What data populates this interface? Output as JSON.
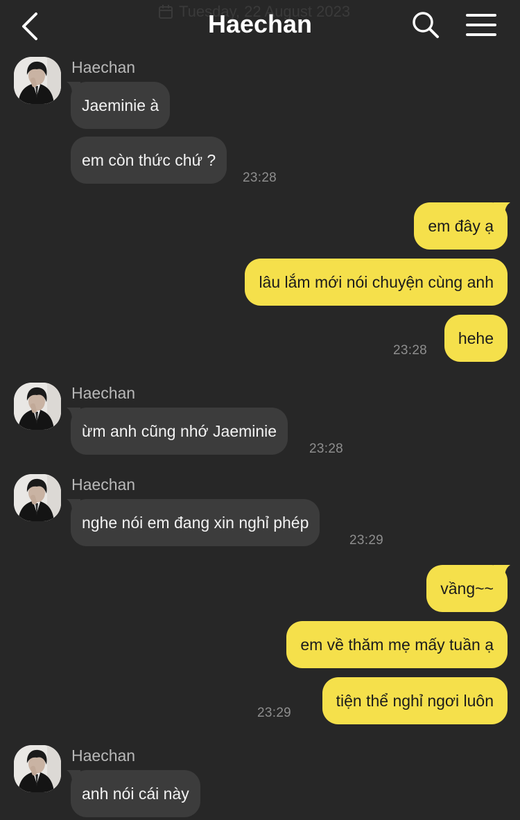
{
  "header": {
    "title": "Haechan",
    "date_hint": "Tuesday, 22 August 2023"
  },
  "colors": {
    "background": "#272727",
    "incoming_bubble": "#3c3c3c",
    "outgoing_bubble": "#f5e04b"
  },
  "icons": {
    "back": "chevron-left-icon",
    "search": "search-icon",
    "menu": "menu-icon",
    "date": "calendar-icon"
  },
  "messages": {
    "g1": {
      "sender": "Haechan",
      "m1": "Jaeminie à",
      "m2": "em còn thức chứ ?",
      "time": "23:28"
    },
    "g2": {
      "m1": "em đây ạ",
      "m2": "lâu lắm mới nói chuyện cùng anh",
      "m3": "hehe",
      "time": "23:28"
    },
    "g3": {
      "sender": "Haechan",
      "m1": "ừm anh cũng nhớ Jaeminie",
      "time": "23:28"
    },
    "g4": {
      "sender": "Haechan",
      "m1": "nghe nói em đang xin nghỉ phép",
      "time": "23:29"
    },
    "g5": {
      "m1": "vầng~~",
      "m2": "em về thăm mẹ mấy tuần ạ",
      "m3": "tiện thể nghỉ ngơi luôn",
      "time": "23:29"
    },
    "g6": {
      "sender": "Haechan",
      "m1": "anh nói cái này"
    }
  }
}
